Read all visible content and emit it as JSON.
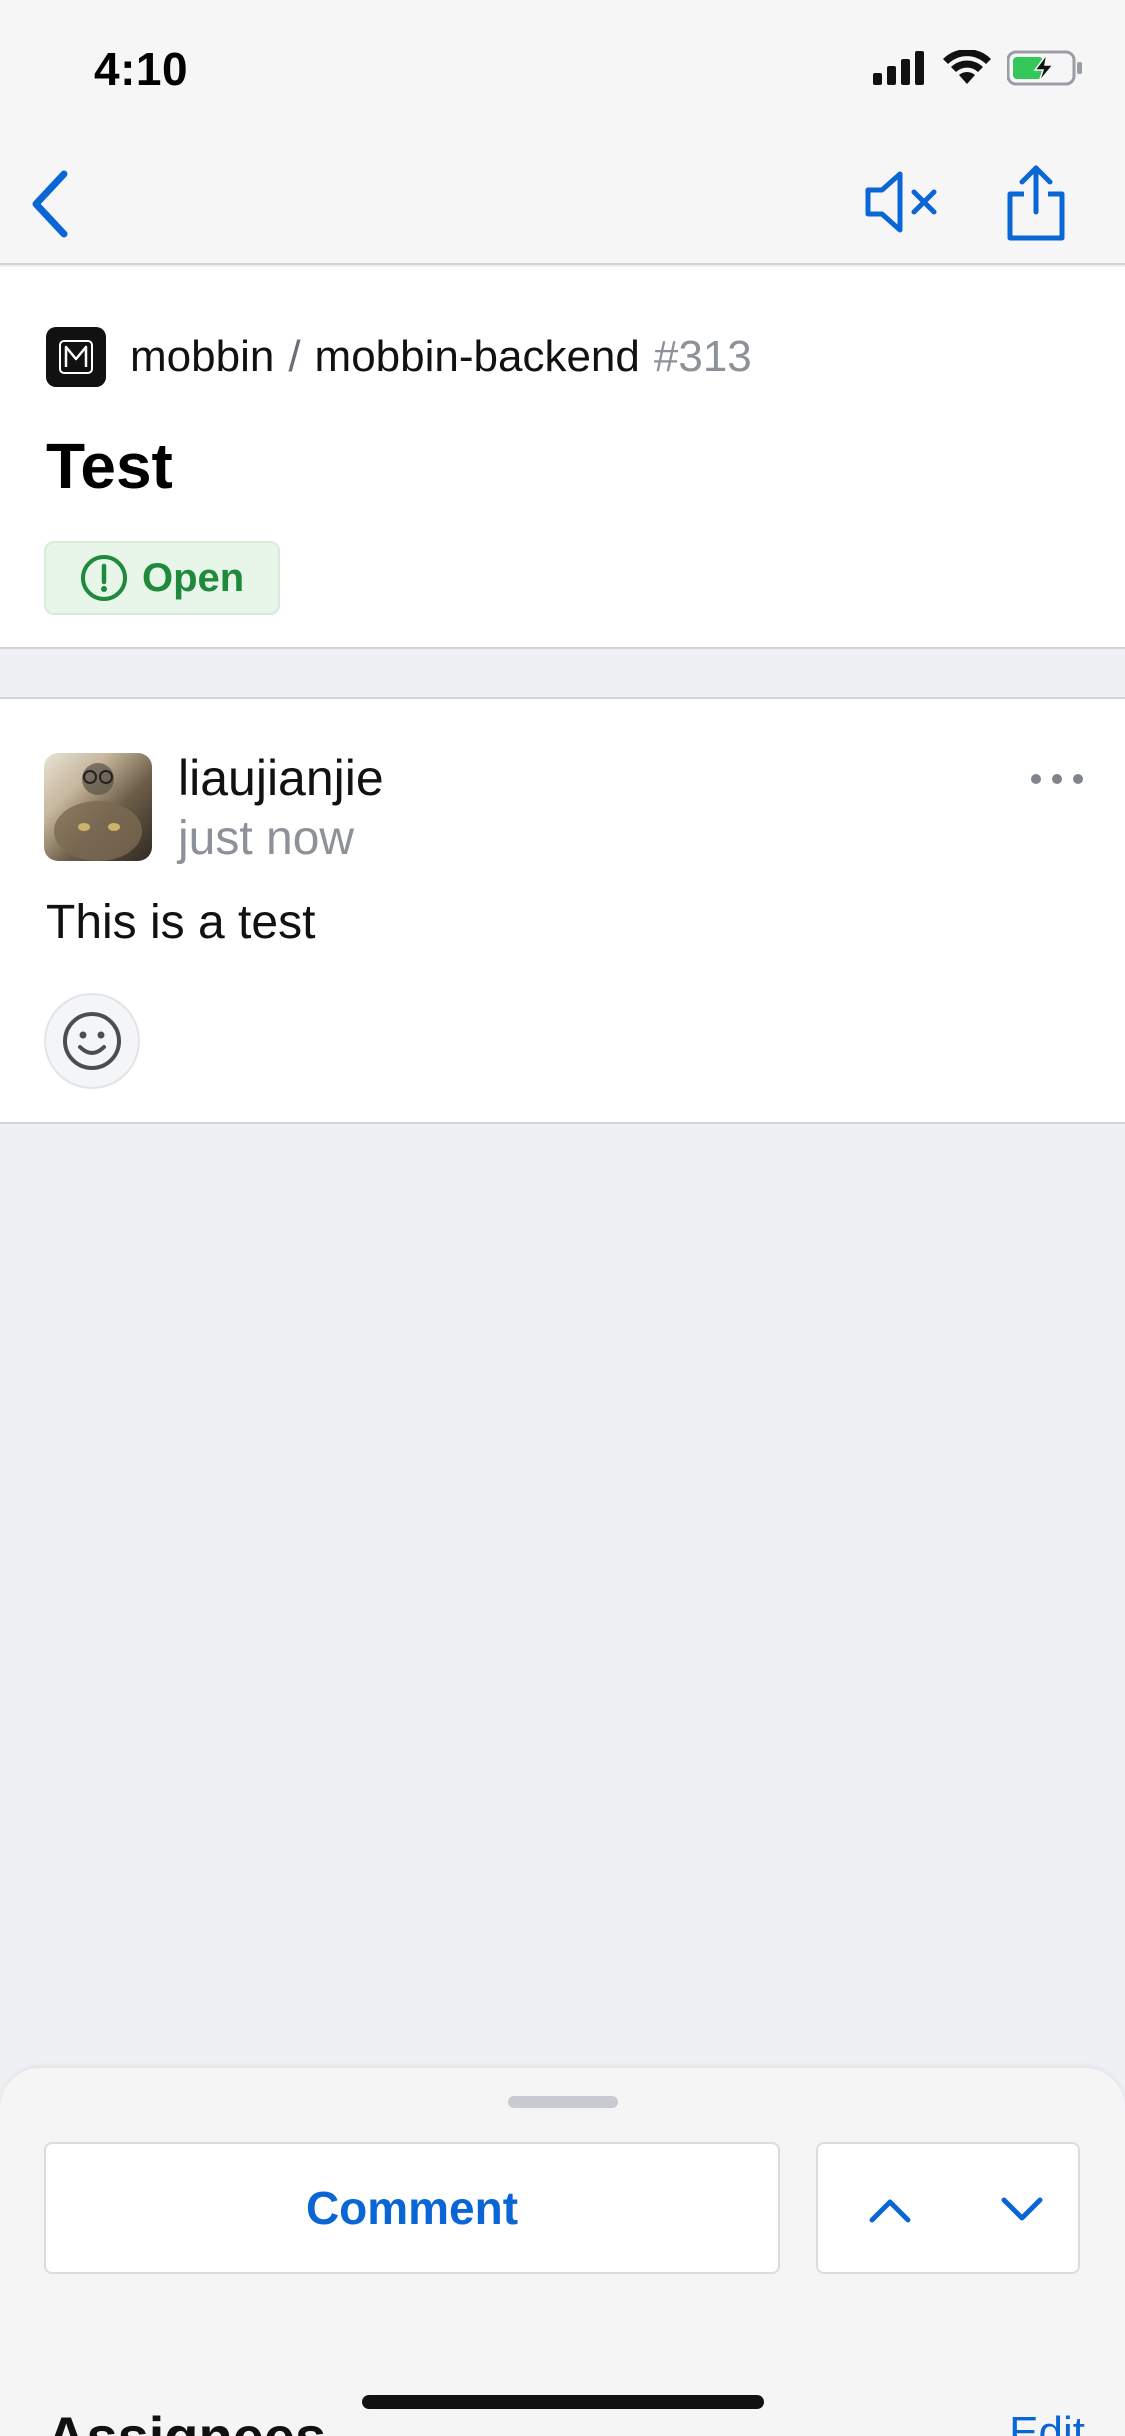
{
  "status_bar": {
    "time": "4:10"
  },
  "nav": {
    "back_icon": "chevron-left-icon",
    "mute_icon": "speaker-mute-icon",
    "share_icon": "share-icon"
  },
  "issue": {
    "owner": "mobbin",
    "separator": "/",
    "repo": "mobbin-backend",
    "number": "#313",
    "title": "Test",
    "state": "Open"
  },
  "comment": {
    "author": "liaujianjie",
    "time": "just now",
    "body": "This is a test"
  },
  "bottom_sheet": {
    "comment_button": "Comment",
    "section_title": "Assignees",
    "edit_link": "Edit"
  },
  "colors": {
    "accent": "#0a66d4",
    "open_green": "#1f8a3b",
    "open_bg": "#e8f6ea",
    "muted_text": "#8d9198"
  }
}
